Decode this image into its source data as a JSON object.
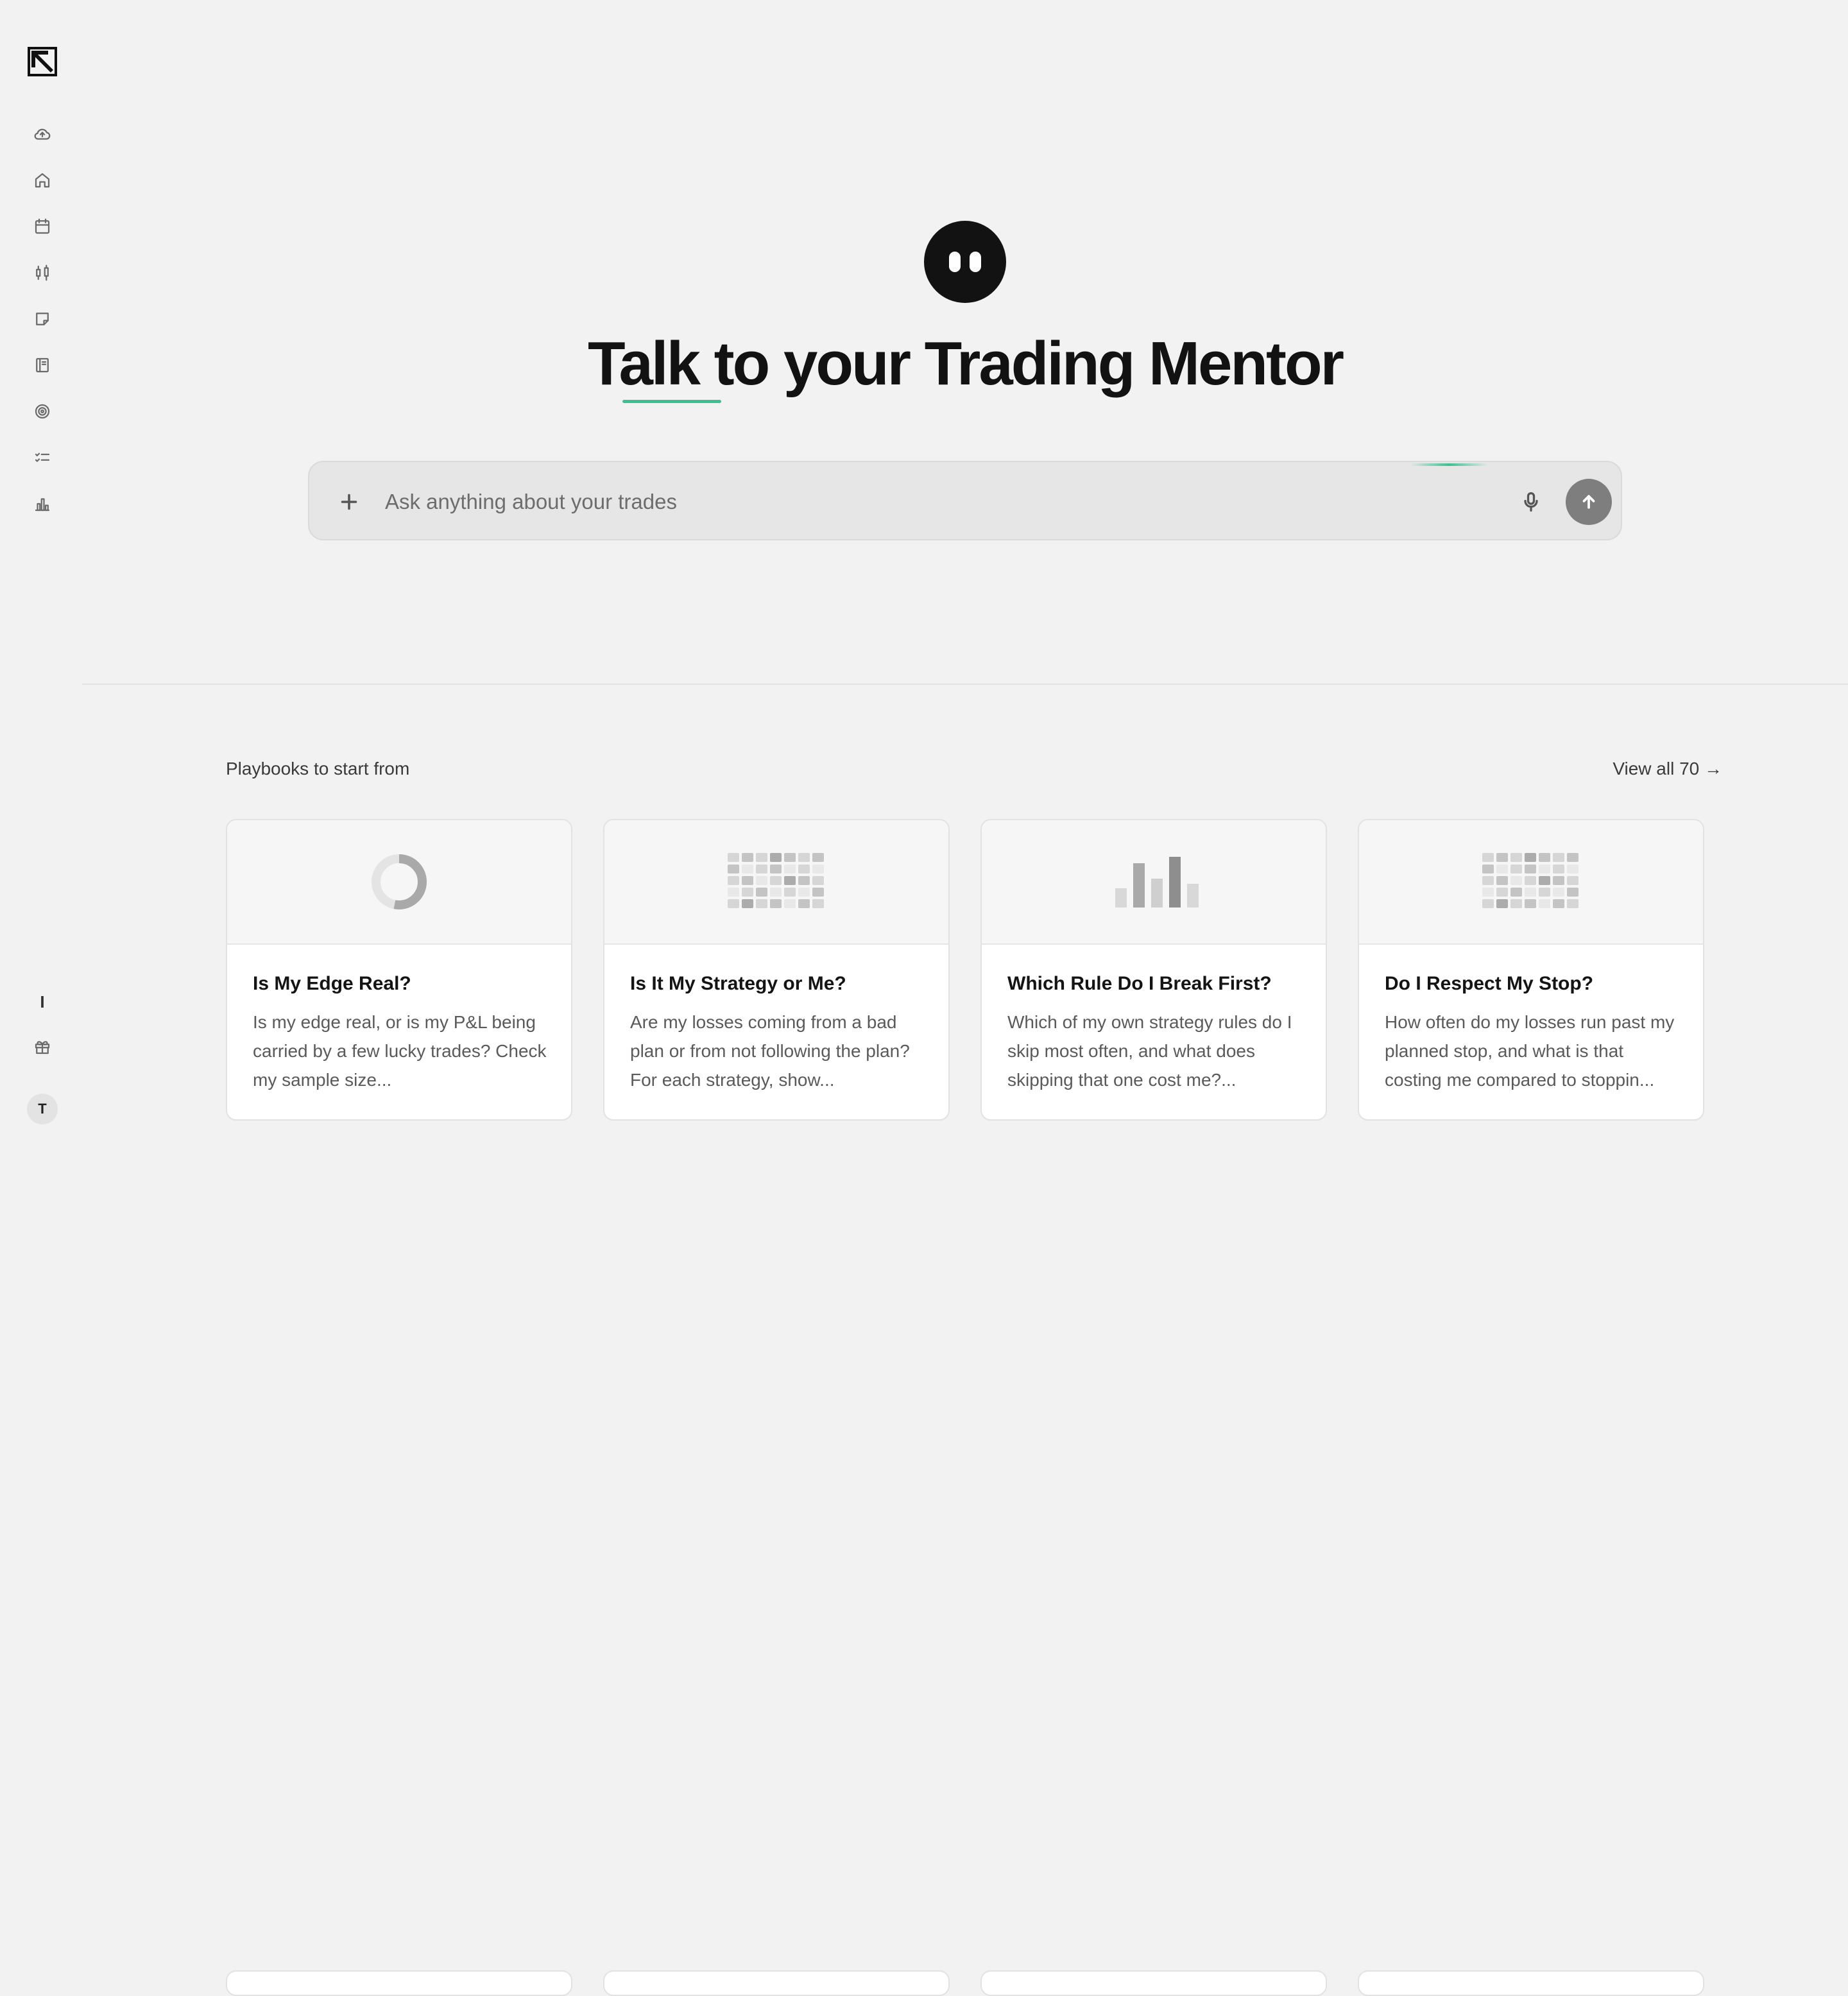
{
  "sidebar": {
    "icons": [
      "cloud-upload-icon",
      "home-icon",
      "calendar-icon",
      "candlestick-icon",
      "note-icon",
      "notebook-icon",
      "target-icon",
      "checklist-icon",
      "bar-chart-icon"
    ],
    "bottom_text": "I",
    "gift_icon": "gift-icon",
    "avatar_initial": "T"
  },
  "hero": {
    "title": "Talk to your Trading Mentor",
    "accent_color": "#3cc08f"
  },
  "search": {
    "placeholder": "Ask anything about your trades",
    "value": ""
  },
  "playbooks": {
    "section_title": "Playbooks to start from",
    "view_all": "View all 70 →",
    "cards": [
      {
        "icon": "donut-chart-icon",
        "title": "Is My Edge Real?",
        "description": "Is my edge real, or is my P&L being carried by a few lucky trades? Check my sample size..."
      },
      {
        "icon": "heatmap-grid-icon",
        "title": "Is It My Strategy or Me?",
        "description": "Are my losses coming from a bad plan or from not following the plan? For each strategy, show..."
      },
      {
        "icon": "bar-chart-icon",
        "title": "Which Rule Do I Break First?",
        "description": "Which of my own strategy rules do I skip most often, and what does skipping that one cost me?..."
      },
      {
        "icon": "heatmap-grid-icon",
        "title": "Do I Respect My Stop?",
        "description": "How often do my losses run past my planned stop, and what is that costing me compared to stoppin..."
      }
    ]
  }
}
